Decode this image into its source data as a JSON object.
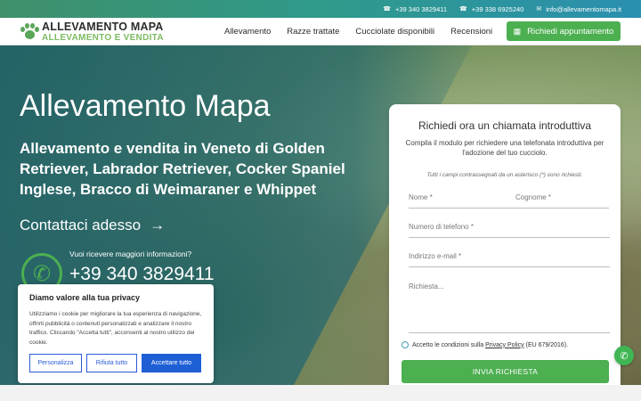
{
  "topbar": {
    "phone1": "+39 340 3829411",
    "phone2": "+39 338 6925240",
    "email": "info@allevamentomapa.it",
    "phone_icon": "phone-icon",
    "mail_icon": "mail-icon"
  },
  "header": {
    "logo_main": "ALLEVAMENTO MAPA",
    "logo_sub": "ALLEVAMENTO E VENDITA",
    "nav": [
      "Allevamento",
      "Razze trattate",
      "Cucciolate disponibili",
      "Recensioni"
    ],
    "cta_label": "Richiedi appuntamento",
    "cta_icon": "calendar-icon"
  },
  "hero": {
    "title": "Allevamento Mapa",
    "subtitle": "Allevamento e vendita in Veneto di Golden Retriever, Labrador Retriever, Cocker Spaniel Inglese, Bracco di Weimaraner e Whippet",
    "contact_link": "Contattaci adesso",
    "contact_arrow": "→",
    "info_question": "Vuoi ricevere maggiori informazioni?",
    "info_phone": "+39 340 3829411"
  },
  "form": {
    "title": "Richiedi ora un chiamata introduttiva",
    "description": "Compila il modulo per richiedere una telefonata introduttiva per l'adozione del tuo cucciolo.",
    "required_note": "Tutti i campi contrassegnati da un asterisco (*) sono richiesti.",
    "fields": {
      "nome": "Nome *",
      "cognome": "Cognome *",
      "telefono": "Numero di telefono *",
      "email": "Indirizzo e-mail *",
      "richiesta": "Richiesta..."
    },
    "consent_prefix": "Accetto le condizioni sulla ",
    "consent_link": "Privacy Policy",
    "consent_suffix": " (EU 679/2016).",
    "submit": "INVIA RICHIESTA"
  },
  "cookie": {
    "title": "Diamo valore alla tua privacy",
    "text": "Utilizziamo i cookie per migliorare la tua esperienza di navigazione, offrirti pubblicità o contenuti personalizzati e analizzare il nostro traffico. Cliccando \"Accetta tutti\", acconsenti al nostro utilizzo dei cookie.",
    "btn_customize": "Personalizza",
    "btn_reject": "Rifiuta tutto",
    "btn_accept": "Accettare tutto"
  },
  "colors": {
    "accent_green": "#4caf50",
    "overlay_teal": "#14606e",
    "cookie_blue": "#1f5fd6"
  }
}
